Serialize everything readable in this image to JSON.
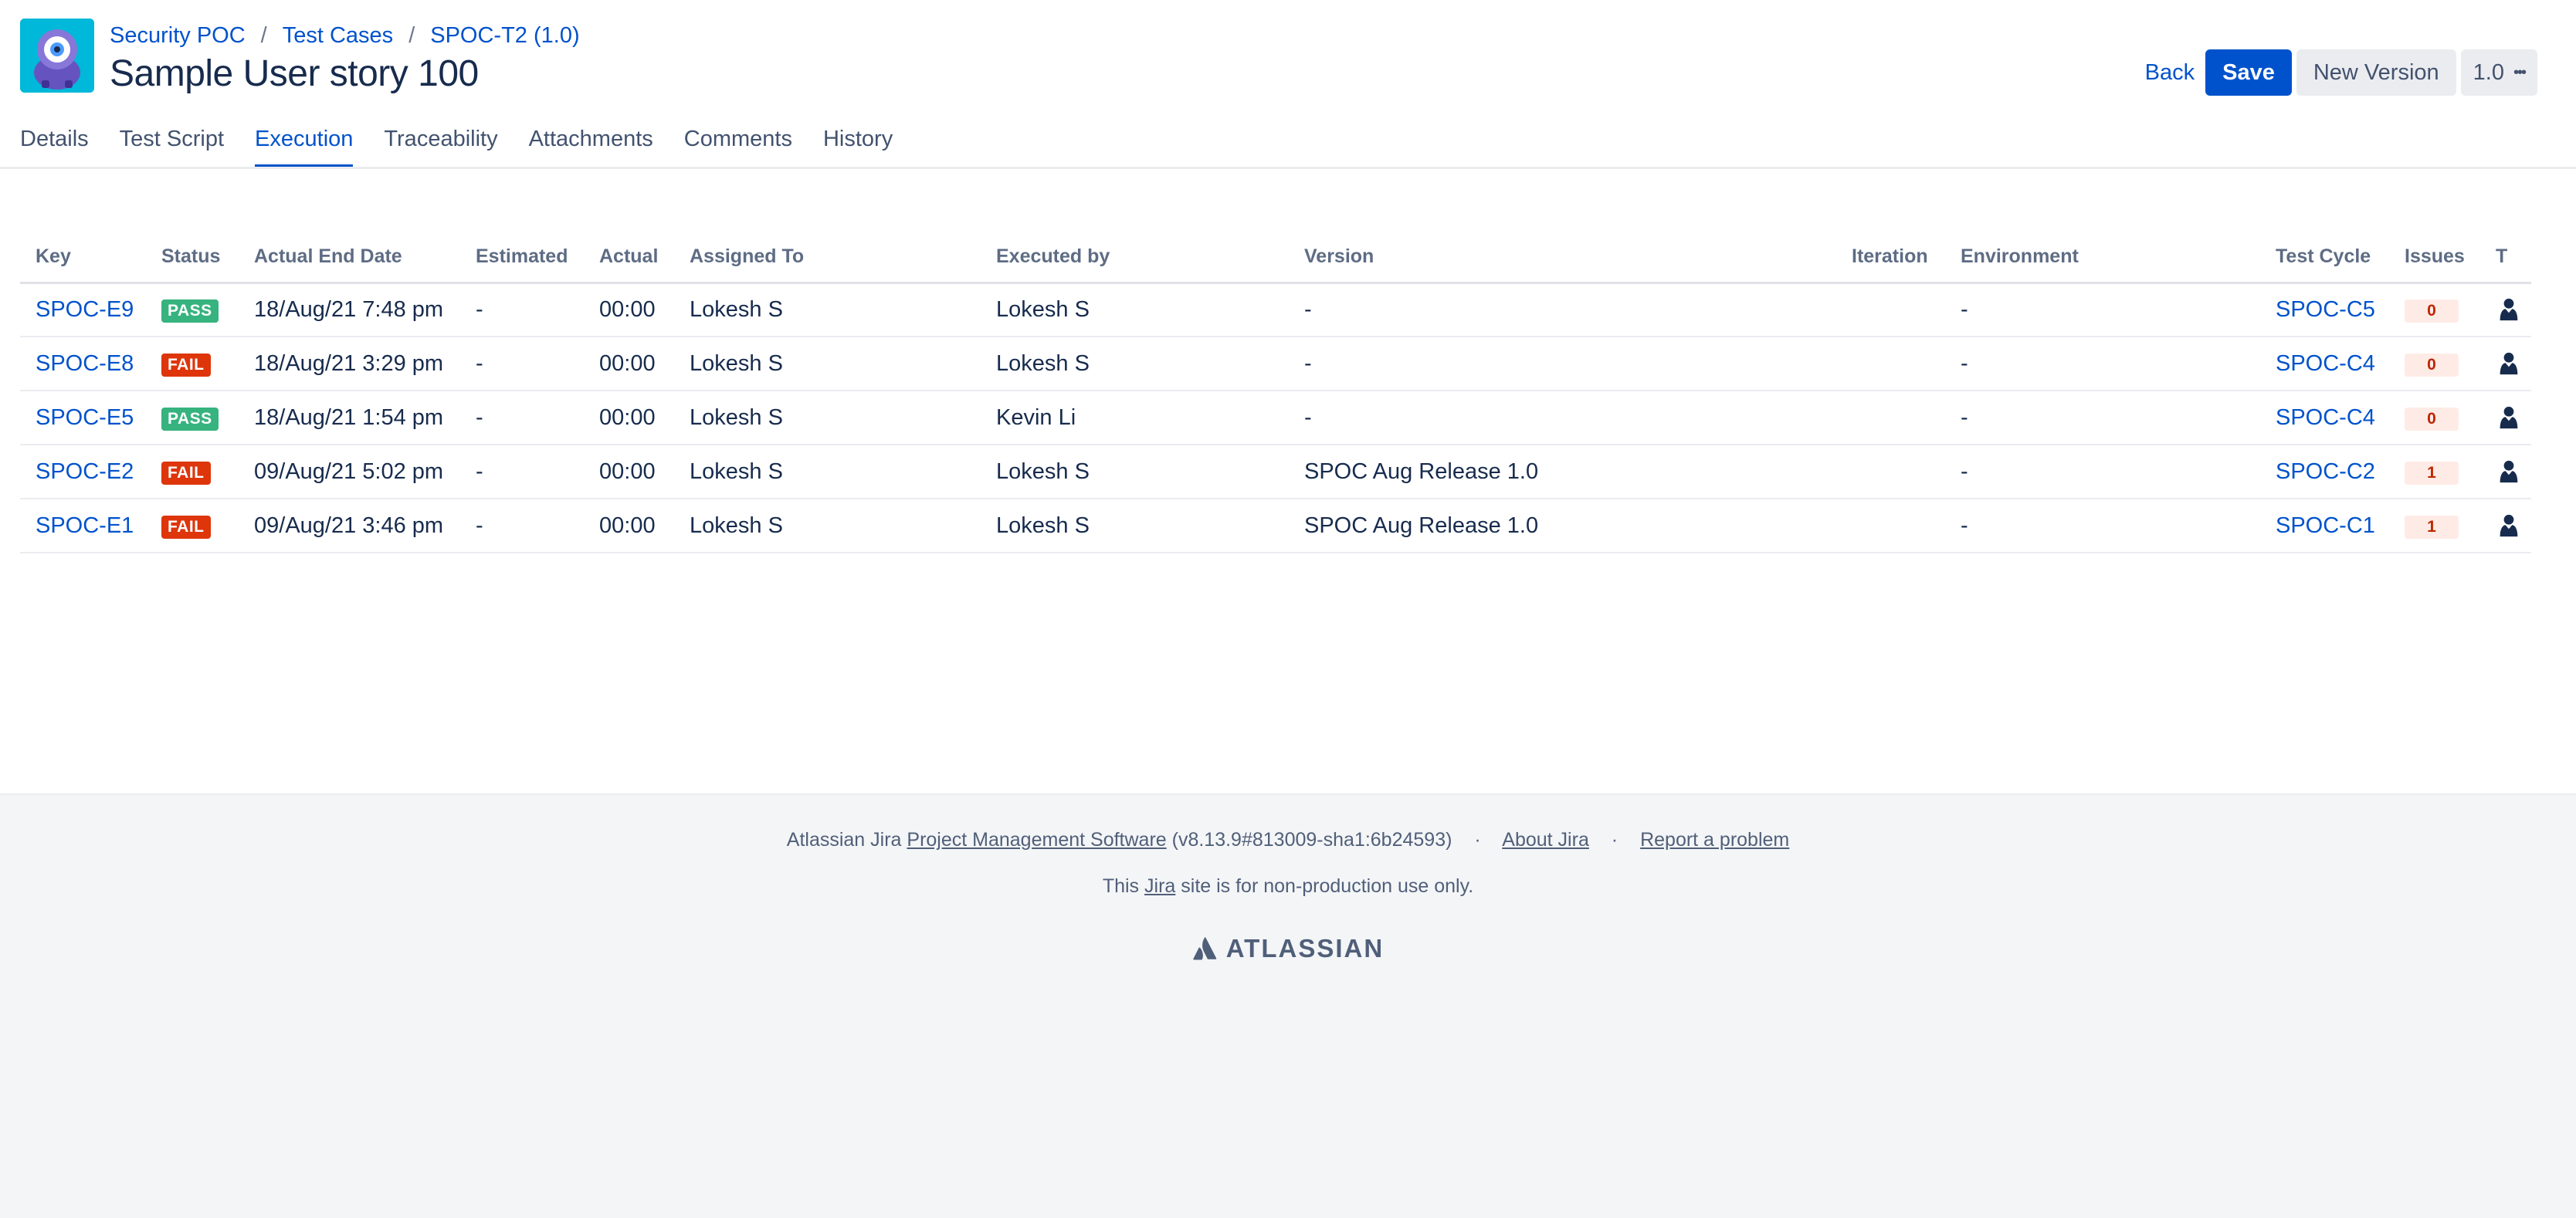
{
  "breadcrumb": {
    "project": "Security POC",
    "section": "Test Cases",
    "item": "SPOC-T2 (1.0)",
    "separator": "/"
  },
  "page": {
    "title": "Sample User story 100"
  },
  "actions": {
    "back": "Back",
    "save": "Save",
    "new_version": "New Version",
    "version": "1.0",
    "more": "•••"
  },
  "tabs": [
    {
      "label": "Details",
      "active": false
    },
    {
      "label": "Test Script",
      "active": false
    },
    {
      "label": "Execution",
      "active": true
    },
    {
      "label": "Traceability",
      "active": false
    },
    {
      "label": "Attachments",
      "active": false
    },
    {
      "label": "Comments",
      "active": false
    },
    {
      "label": "History",
      "active": false
    }
  ],
  "table": {
    "columns": [
      "Key",
      "Status",
      "Actual End Date",
      "Estimated",
      "Actual",
      "Assigned To",
      "Executed by",
      "Version",
      "Iteration",
      "Environment",
      "Test Cycle",
      "Issues",
      "T"
    ],
    "rows": [
      {
        "key": "SPOC-E9",
        "status": "PASS",
        "end_date": "18/Aug/21 7:48 pm",
        "estimated": "-",
        "actual": "00:00",
        "assigned_to": "Lokesh S",
        "executed_by": "Lokesh S",
        "version": "-",
        "iteration": "",
        "environment": "-",
        "test_cycle": "SPOC-C5",
        "issues": "0"
      },
      {
        "key": "SPOC-E8",
        "status": "FAIL",
        "end_date": "18/Aug/21 3:29 pm",
        "estimated": "-",
        "actual": "00:00",
        "assigned_to": "Lokesh S",
        "executed_by": "Lokesh S",
        "version": "-",
        "iteration": "",
        "environment": "-",
        "test_cycle": "SPOC-C4",
        "issues": "0"
      },
      {
        "key": "SPOC-E5",
        "status": "PASS",
        "end_date": "18/Aug/21 1:54 pm",
        "estimated": "-",
        "actual": "00:00",
        "assigned_to": "Lokesh S",
        "executed_by": "Kevin Li",
        "version": "-",
        "iteration": "",
        "environment": "-",
        "test_cycle": "SPOC-C4",
        "issues": "0"
      },
      {
        "key": "SPOC-E2",
        "status": "FAIL",
        "end_date": "09/Aug/21 5:02 pm",
        "estimated": "-",
        "actual": "00:00",
        "assigned_to": "Lokesh S",
        "executed_by": "Lokesh S",
        "version": "SPOC Aug Release 1.0",
        "iteration": "",
        "environment": "-",
        "test_cycle": "SPOC-C2",
        "issues": "1"
      },
      {
        "key": "SPOC-E1",
        "status": "FAIL",
        "end_date": "09/Aug/21 3:46 pm",
        "estimated": "-",
        "actual": "00:00",
        "assigned_to": "Lokesh S",
        "executed_by": "Lokesh S",
        "version": "SPOC Aug Release 1.0",
        "iteration": "",
        "environment": "-",
        "test_cycle": "SPOC-C1",
        "issues": "1"
      }
    ]
  },
  "footer": {
    "prefix": "Atlassian Jira",
    "pms_link": "Project Management Software",
    "build": "(v8.13.9#813009-sha1:6b24593)",
    "dot": "·",
    "about": "About Jira",
    "report": "Report a problem",
    "notice_before": "This",
    "notice_link": "Jira",
    "notice_after": "site is for non-production use only.",
    "logo_text": "ATLASSIAN"
  },
  "colors": {
    "primary": "#0052cc",
    "pass": "#36b37e",
    "fail": "#de350b",
    "issue_bg": "#ffebe6",
    "issue_text": "#bf2600",
    "avatar_bg": "#00b8d9",
    "footer_bg": "#f4f5f7"
  },
  "icons": {
    "project_avatar": "monster-avatar-icon",
    "tester": "person-icon",
    "logo": "atlassian-logo-icon"
  }
}
